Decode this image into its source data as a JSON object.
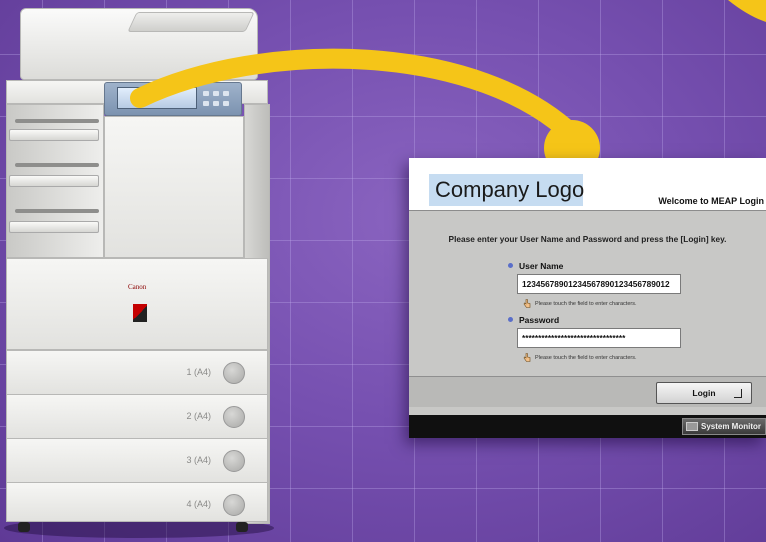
{
  "copier": {
    "brand": "Canon",
    "drawer_labels": [
      "1 (A4)",
      "2 (A4)",
      "3 (A4)",
      "4 (A4)"
    ]
  },
  "login_screen": {
    "logo_text": "Company Logo",
    "welcome_title": "Welcome to MEAP Login",
    "instruction": "Please enter your User Name and Password and press the [Login] key.",
    "username_label": "User Name",
    "username_value": "12345678901234567890123456789012",
    "username_hint": "Please touch the field to enter characters.",
    "password_label": "Password",
    "password_value": "********************************",
    "password_hint": "Please touch the field to enter characters.",
    "login_label": "Login",
    "system_monitor_label": "System Monitor"
  },
  "colors": {
    "background": "#7650b0",
    "curve": "#f5c518",
    "logo_bg": "#c6dcf1",
    "field_bullet": "#5a6ec9"
  },
  "icons": {
    "hand": "hand-pointer-icon",
    "enter": "enter-icon",
    "monitor": "system-monitor-icon"
  }
}
